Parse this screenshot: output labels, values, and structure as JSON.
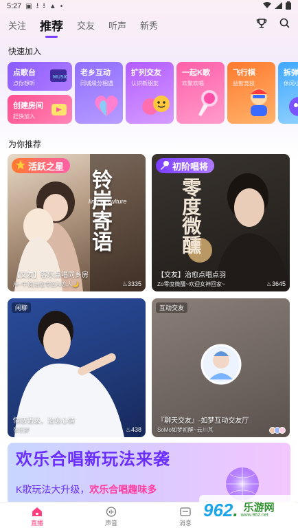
{
  "status_bar": {
    "time": "5:27",
    "icons": [
      "notification-icon",
      "download-icon",
      "download-icon",
      "a-icon",
      "dot-icon",
      "wifi-icon",
      "signal-icon",
      "battery-icon"
    ]
  },
  "top_nav": {
    "tabs": [
      "关注",
      "推荐",
      "交友",
      "听声",
      "新秀"
    ],
    "active_tab": "推荐"
  },
  "quick_join": {
    "title": "快速加入",
    "cards": [
      {
        "title": "点歌台",
        "subtitle": "点你想听",
        "color": "#8a5cff"
      },
      {
        "title": "创建房间",
        "subtitle": "赶快加入",
        "color": "#ff5b9a"
      },
      {
        "title": "老乡互动",
        "subtitle": "同城缘分相遇",
        "color": "#a27bff"
      },
      {
        "title": "扩列交友",
        "subtitle": "认识新朋友",
        "color": "#c36bff"
      },
      {
        "title": "一起K歌",
        "subtitle": "欢聚欢唱",
        "color": "#ff6fb0"
      },
      {
        "title": "飞行棋",
        "subtitle": "益智竞技",
        "color": "#ff8a3d"
      },
      {
        "title": "拆弹猫",
        "subtitle": "休闲小游戏",
        "color": "#4cb8ff"
      }
    ]
  },
  "recommend": {
    "title": "为你推荐",
    "cards": [
      {
        "tag": "活跃之星",
        "title": "【交友】客乐点唱同乡房",
        "sub": "岸~午夜|治愈专区AI恋人🌙",
        "heat": "3335",
        "poster_title": "铃岸寄语",
        "poster_sub": "ling ya culture"
      },
      {
        "tag": "初阶唱将",
        "title": "【交友】治愈点唱点羽",
        "sub": "Zo零度微醺~欢迎女神回家~",
        "heat": "3645",
        "poster_title": "零度微醺"
      },
      {
        "tag": "闲聊",
        "title": "情感语录，治愈心情",
        "sub": "张乐梦",
        "heat": "438"
      },
      {
        "tag": "互动交友",
        "title": "『聊天交友』-如梦互动交友厅",
        "sub": "SoMo如梦初醒~云川芃",
        "heat": ""
      }
    ]
  },
  "banner": {
    "title": "欢乐合唱新玩法来袭",
    "subtitle_prefix": "K歌玩法大升级，",
    "subtitle_highlight": "欢乐合唱趣味多"
  },
  "bottom_nav": {
    "items": [
      "直播",
      "声音",
      "消息"
    ],
    "active": "直播"
  },
  "watermark": {
    "number": "962",
    "dot": ".",
    "text": "乐游网",
    "url": "www.962.net"
  },
  "colors": {
    "accent": "#7a3cff",
    "brand_pink": "#ff3d7f",
    "banner_text": "#6a2fff"
  }
}
